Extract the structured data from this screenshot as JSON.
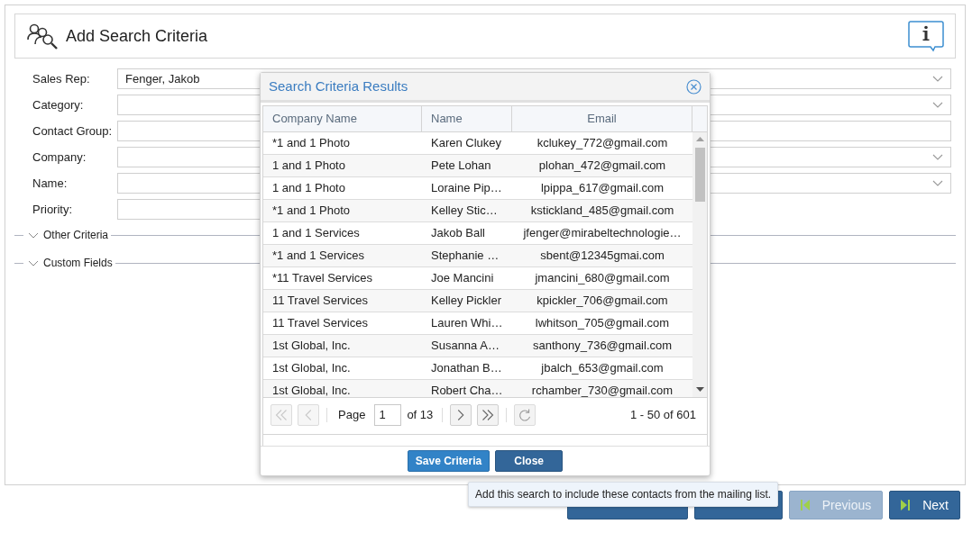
{
  "header": {
    "title": "Add Search Criteria"
  },
  "fields": [
    {
      "label": "Sales Rep:",
      "kind": "dropdown",
      "value": "Fenger, Jakob"
    },
    {
      "label": "Category:",
      "kind": "dropdown"
    },
    {
      "label": "Contact Group:",
      "kind": "text"
    },
    {
      "label": "Company:",
      "kind": "dropdown"
    },
    {
      "label": "Name:",
      "kind": "dropdown"
    },
    {
      "label": "Priority:",
      "kind": "short"
    }
  ],
  "sections": [
    {
      "label": "Other Criteria",
      "expanded": false
    },
    {
      "label": "Custom Fields",
      "expanded": false
    }
  ],
  "dialog": {
    "title": "Search Criteria Results",
    "table": {
      "columns": [
        "Company Name",
        "Name",
        "Email"
      ],
      "rows": [
        [
          "*1 and 1 Photo",
          "Karen Clukey",
          "kclukey_772@gmail.com"
        ],
        [
          "1 and 1 Photo",
          "Pete Lohan",
          "plohan_472@gmail.com"
        ],
        [
          "1 and 1 Photo",
          "Loraine Pip…",
          "lpippa_617@gmail.com"
        ],
        [
          "*1 and 1 Photo",
          "Kelley Stic…",
          "kstickland_485@gmail.com"
        ],
        [
          "1 and 1 Services",
          "Jakob Ball",
          "jfenger@mirabeltechnologie…"
        ],
        [
          "*1 and 1 Services",
          "Stephanie …",
          "sbent@12345gmai.com"
        ],
        [
          "*11 Travel Services",
          "Joe Mancini",
          "jmancini_680@gmail.com"
        ],
        [
          "11 Travel Services",
          "Kelley Pickler",
          "kpickler_706@gmail.com"
        ],
        [
          "11 Travel Services",
          "Lauren Whi…",
          "lwhitson_705@gmail.com"
        ],
        [
          "1st Global, Inc.",
          "Susanna A…",
          "santhony_736@gmail.com"
        ],
        [
          "1st Global, Inc.",
          "Jonathan B…",
          "jbalch_653@gmail.com"
        ],
        [
          "1st Global, Inc.",
          "Robert Cha…",
          "rchamber_730@gmail.com"
        ]
      ]
    },
    "pager": {
      "page_label": "Page",
      "page": "1",
      "of": "of 13",
      "summary": "1 - 50 of 601"
    },
    "buttons": [
      {
        "label": "Save Criteria",
        "kind": "primary"
      },
      {
        "label": "Close",
        "kind": "secondary"
      }
    ]
  },
  "tooltip": "Add this search to include these contacts from the mailing list.",
  "nav_buttons": [
    {
      "kind": "wide",
      "disabled": false
    },
    {
      "kind": "narrow",
      "disabled": false
    },
    {
      "label": "Previous",
      "kind": "prev",
      "disabled": true
    },
    {
      "label": "Next",
      "kind": "next",
      "disabled": false
    }
  ]
}
